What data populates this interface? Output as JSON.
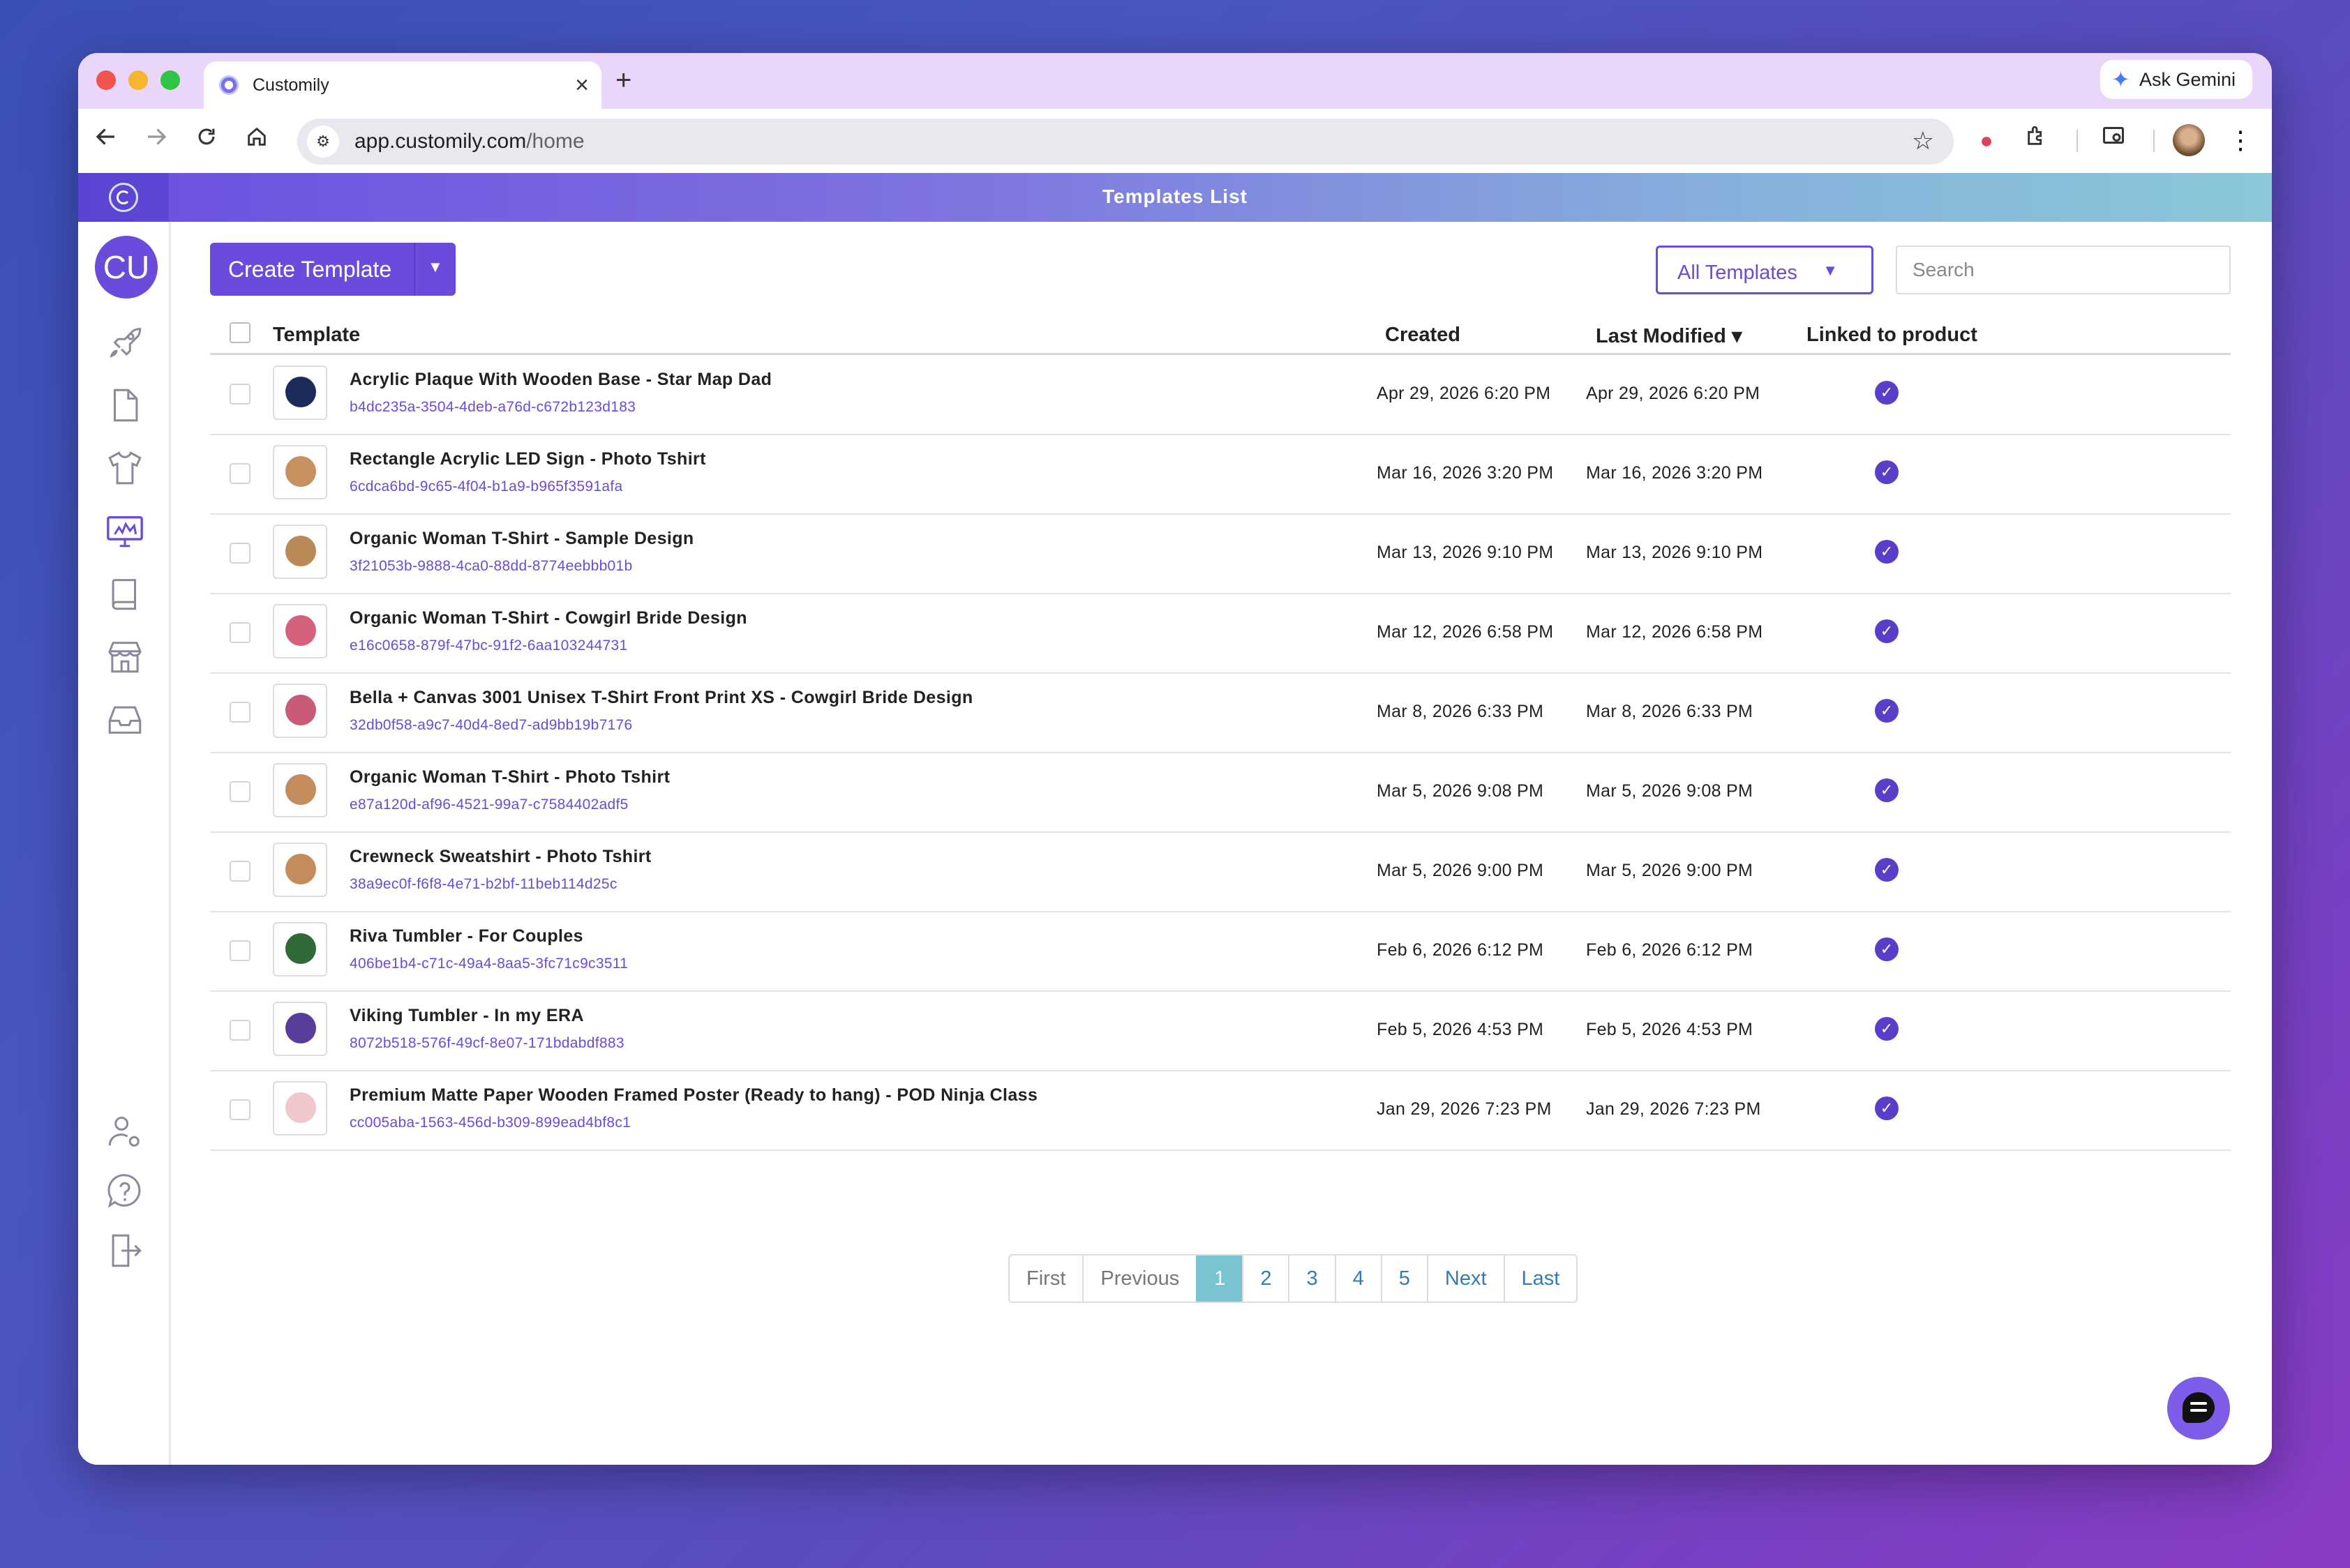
{
  "browser": {
    "tab_title": "Customily",
    "tab_close": "×",
    "new_tab": "+",
    "gemini_label": "Ask Gemini",
    "url_domain": "app.customily.com",
    "url_path": "/home"
  },
  "app": {
    "header_title": "Templates List",
    "user_initials": "CU"
  },
  "toolbar": {
    "create_label": "Create Template",
    "filter_label": "All Templates",
    "search_placeholder": "Search"
  },
  "table": {
    "columns": {
      "template": "Template",
      "created": "Created",
      "modified": "Last Modified",
      "linked": "Linked to product"
    },
    "sort_indicator": "▾",
    "rows": [
      {
        "name": "Acrylic Plaque With Wooden Base - Star Map Dad",
        "id": "b4dc235a-3504-4deb-a76d-c672b123d183",
        "created": "Apr 29, 2026 6:20 PM",
        "modified": "Apr 29, 2026 6:20 PM",
        "linked": true,
        "thumb_color": "#1d2a5a"
      },
      {
        "name": "Rectangle Acrylic LED Sign - Photo Tshirt",
        "id": "6cdca6bd-9c65-4f04-b1a9-b965f3591afa",
        "created": "Mar 16, 2026 3:20 PM",
        "modified": "Mar 16, 2026 3:20 PM",
        "linked": true,
        "thumb_color": "#c79060"
      },
      {
        "name": "Organic Woman T-Shirt - Sample Design",
        "id": "3f21053b-9888-4ca0-88dd-8774eebbb01b",
        "created": "Mar 13, 2026 9:10 PM",
        "modified": "Mar 13, 2026 9:10 PM",
        "linked": true,
        "thumb_color": "#b98a58"
      },
      {
        "name": "Organic Woman T-Shirt - Cowgirl Bride Design",
        "id": "e16c0658-879f-47bc-91f2-6aa103244731",
        "created": "Mar 12, 2026 6:58 PM",
        "modified": "Mar 12, 2026 6:58 PM",
        "linked": true,
        "thumb_color": "#d4607a"
      },
      {
        "name": "Bella + Canvas 3001 Unisex T-Shirt Front Print XS - Cowgirl Bride Design",
        "id": "32db0f58-a9c7-40d4-8ed7-ad9bb19b7176",
        "created": "Mar 8, 2026 6:33 PM",
        "modified": "Mar 8, 2026 6:33 PM",
        "linked": true,
        "thumb_color": "#c95a78"
      },
      {
        "name": "Organic Woman T-Shirt - Photo Tshirt",
        "id": "e87a120d-af96-4521-99a7-c7584402adf5",
        "created": "Mar 5, 2026 9:08 PM",
        "modified": "Mar 5, 2026 9:08 PM",
        "linked": true,
        "thumb_color": "#c48c5c"
      },
      {
        "name": "Crewneck Sweatshirt - Photo Tshirt",
        "id": "38a9ec0f-f6f8-4e71-b2bf-11beb114d25c",
        "created": "Mar 5, 2026 9:00 PM",
        "modified": "Mar 5, 2026 9:00 PM",
        "linked": true,
        "thumb_color": "#c48c5c"
      },
      {
        "name": "Riva Tumbler - For Couples",
        "id": "406be1b4-c71c-49a4-8aa5-3fc71c9c3511",
        "created": "Feb 6, 2026 6:12 PM",
        "modified": "Feb 6, 2026 6:12 PM",
        "linked": true,
        "thumb_color": "#2f6a3a"
      },
      {
        "name": "Viking Tumbler - In my ERA",
        "id": "8072b518-576f-49cf-8e07-171bdabdf883",
        "created": "Feb 5, 2026 4:53 PM",
        "modified": "Feb 5, 2026 4:53 PM",
        "linked": true,
        "thumb_color": "#5a3d9a"
      },
      {
        "name": "Premium Matte Paper Wooden Framed Poster (Ready to hang) - POD Ninja Class",
        "id": "cc005aba-1563-456d-b309-899ead4bf8c1",
        "created": "Jan 29, 2026 7:23 PM",
        "modified": "Jan 29, 2026 7:23 PM",
        "linked": true,
        "thumb_color": "#f0c8cc"
      }
    ]
  },
  "pagination": {
    "first": "First",
    "previous": "Previous",
    "pages": [
      "1",
      "2",
      "3",
      "4",
      "5"
    ],
    "active_page": "1",
    "next": "Next",
    "last": "Last"
  },
  "icons": {
    "linked_check": "✓",
    "dropdown_caret": "▼"
  }
}
